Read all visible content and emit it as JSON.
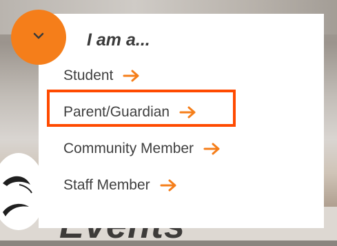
{
  "menu": {
    "title": "I am a...",
    "items": [
      {
        "label": "Student"
      },
      {
        "label": "Parent/Guardian"
      },
      {
        "label": "Community Member"
      },
      {
        "label": "Staff Member"
      }
    ],
    "highlighted_index": 1
  },
  "background": {
    "heading_fragment": "Events"
  },
  "icons": {
    "toggle": "chevron-down-icon",
    "item_arrow": "arrow-right-icon"
  },
  "colors": {
    "accent": "#f57e1a",
    "highlight_border": "#ff4a00",
    "text": "#3f3f3f"
  }
}
